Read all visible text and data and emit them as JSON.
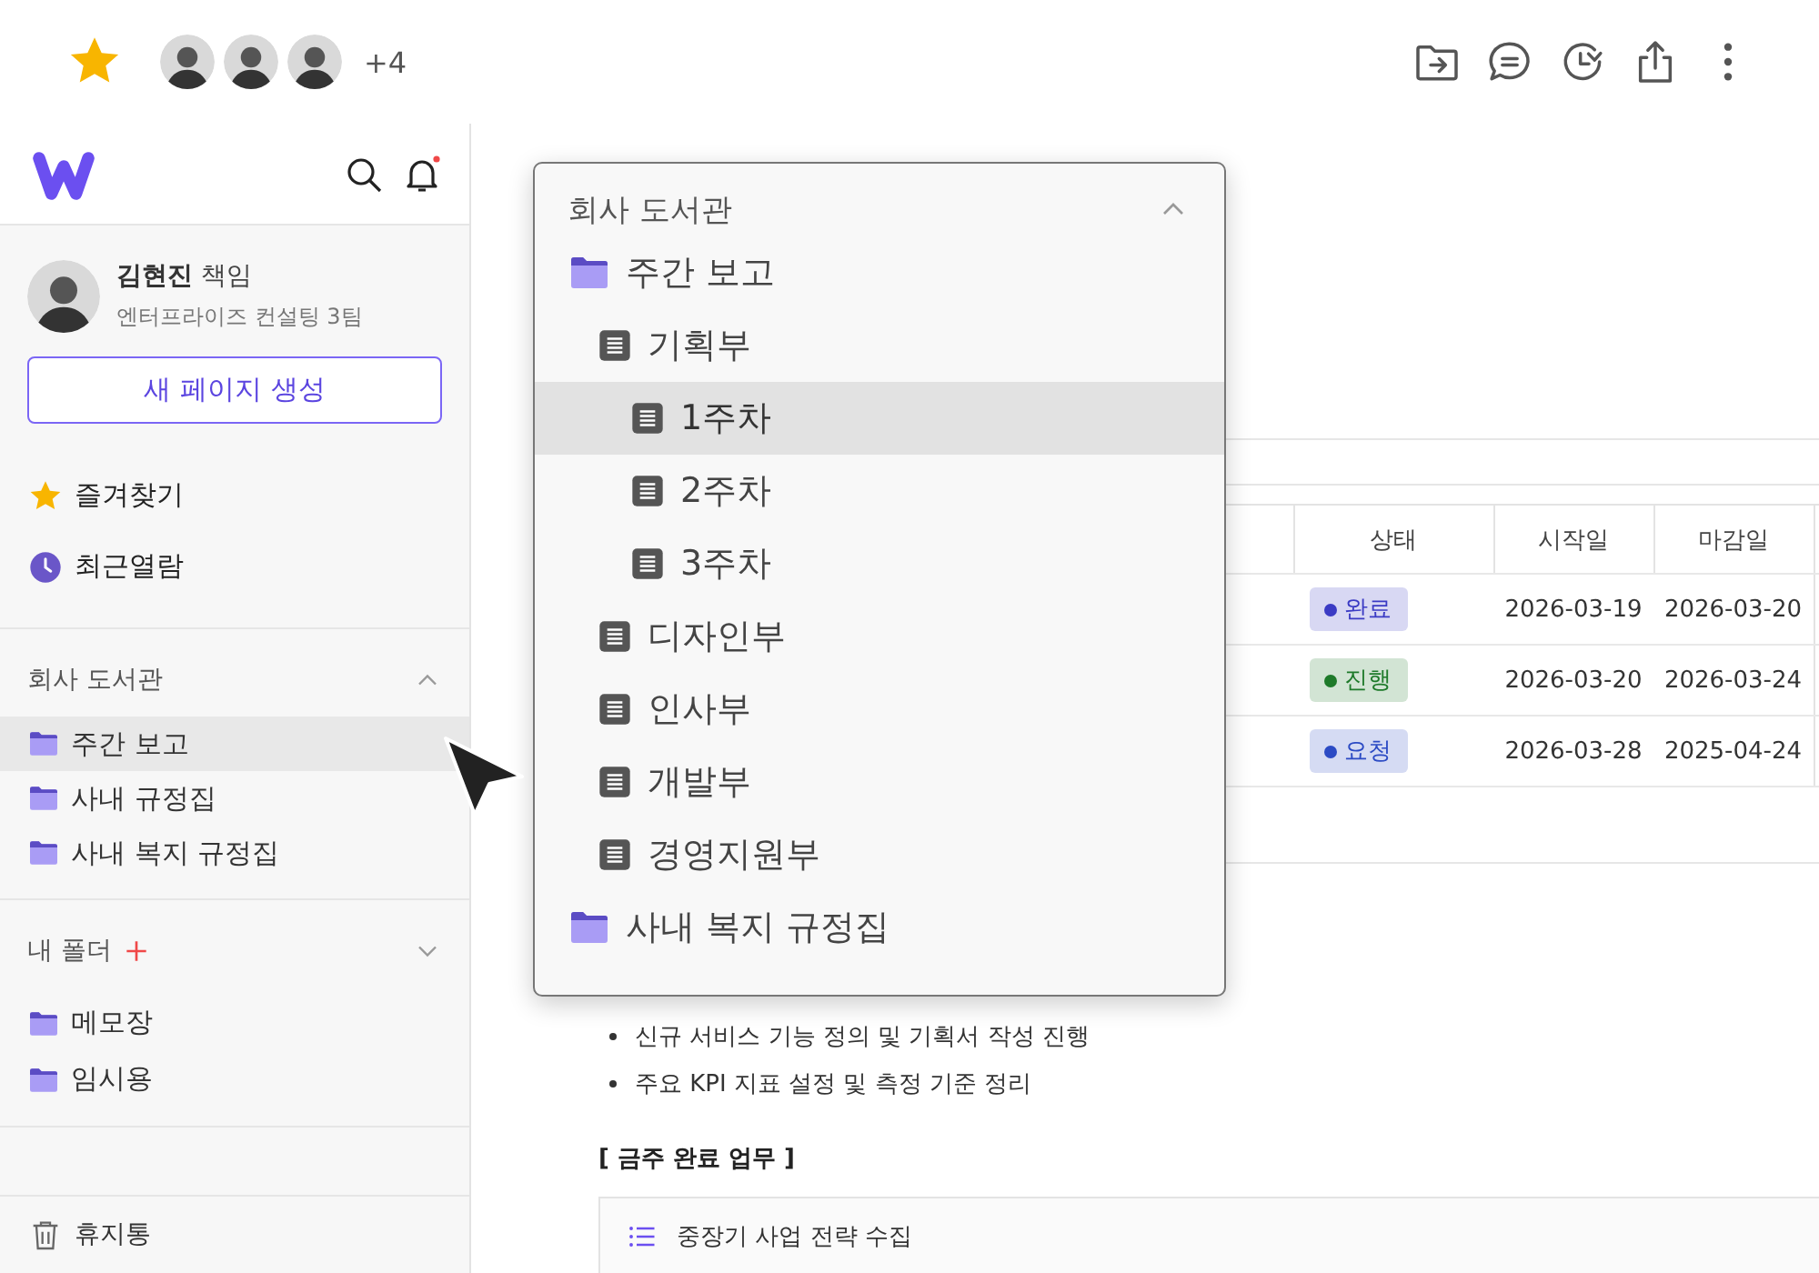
{
  "header": {
    "favorite": true,
    "extra_members": "+4",
    "members": [
      {
        "kind": "avatar"
      },
      {
        "kind": "avatar"
      },
      {
        "kind": "avatar"
      }
    ]
  },
  "sidebar": {
    "user": {
      "name": "김현진",
      "role": "책임",
      "team": "엔터프라이즈 컨설팅 3팀"
    },
    "new_page_button": "새 페이지 생성",
    "quick_links": [
      {
        "kind": "favorites",
        "label": "즐겨찾기"
      },
      {
        "kind": "recent",
        "label": "최근열람"
      }
    ],
    "sections": [
      {
        "title": "회사 도서관",
        "expanded": true,
        "items": [
          {
            "label": "주간 보고",
            "selected": true
          },
          {
            "label": "사내 규정집",
            "selected": false
          },
          {
            "label": "사내 복지 규정집",
            "selected": false
          }
        ]
      },
      {
        "title": "내 폴더",
        "expanded": false,
        "can_add": true,
        "items": [
          {
            "label": "메모장",
            "selected": false
          },
          {
            "label": "임시용",
            "selected": false
          }
        ]
      }
    ],
    "trash": "휴지통"
  },
  "table": {
    "columns": [
      "상태",
      "시작일",
      "마감일"
    ],
    "rows": [
      {
        "status": {
          "label": "완료",
          "color": "#3b3bc4"
        },
        "start": "2026-03-19",
        "end": "2026-03-20"
      },
      {
        "status": {
          "label": "진행",
          "color": "#1e7a2a"
        },
        "start": "2026-03-20",
        "end": "2026-03-24"
      },
      {
        "status": {
          "label": "요청",
          "color": "#2c4bc4"
        },
        "start": "2026-03-28",
        "end": "2025-04-24"
      }
    ]
  },
  "bullets": [
    "신규 서비스 기능 정의 및 기획서 작성 진행",
    "주요 KPI 지표 설정 및 측정 기준 정리"
  ],
  "completed_heading": "[ 금주 완료 업무 ]",
  "completed_items": [
    "중장기 사업 전략 수집"
  ],
  "popup": {
    "title": "회사 도서관",
    "expanded": true,
    "tree": [
      {
        "kind": "folder",
        "label": "주간 보고",
        "selected": false,
        "children": [
          {
            "kind": "page",
            "label": "기획부",
            "selected": false,
            "children": [
              {
                "kind": "page",
                "label": "1주차",
                "selected": true
              },
              {
                "kind": "page",
                "label": "2주차",
                "selected": false
              },
              {
                "kind": "page",
                "label": "3주차",
                "selected": false
              }
            ]
          },
          {
            "kind": "page",
            "label": "디자인부",
            "selected": false
          },
          {
            "kind": "page",
            "label": "인사부",
            "selected": false
          },
          {
            "kind": "page",
            "label": "개발부",
            "selected": false
          },
          {
            "kind": "page",
            "label": "경영지원부",
            "selected": false
          }
        ]
      },
      {
        "kind": "folder",
        "label": "사내 복지 규정집",
        "selected": false
      }
    ]
  }
}
